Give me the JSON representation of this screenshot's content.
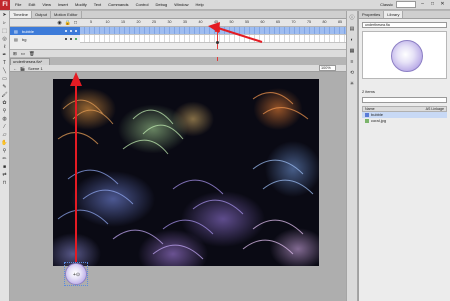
{
  "app": {
    "logo": "Fl"
  },
  "menu": [
    "File",
    "Edit",
    "View",
    "Insert",
    "Modify",
    "Text",
    "Commands",
    "Control",
    "Debug",
    "Window",
    "Help"
  ],
  "workspace": {
    "label": "Classic",
    "minimize": "–",
    "maximize": "□",
    "close": "✕"
  },
  "timeline": {
    "tabs": [
      "Timeline",
      "Output",
      "Motion Editor"
    ],
    "ruler_ticks": [
      "5",
      "10",
      "15",
      "20",
      "25",
      "30",
      "35",
      "40",
      "45",
      "50",
      "55",
      "60",
      "65",
      "70",
      "75",
      "80",
      "85"
    ],
    "layers": [
      {
        "name": "bubble",
        "selected": true
      },
      {
        "name": "bg",
        "selected": false
      }
    ],
    "current_frame": 45
  },
  "document": {
    "tab": "underthesea.fla*",
    "scene": "Scene 1",
    "zoom": "100%"
  },
  "library": {
    "tabs": [
      "Properties",
      "Library"
    ],
    "document": "underthesea.fla",
    "item_count": "2 items",
    "header_name": "Name",
    "header_linkage": "AS Linkage",
    "items": [
      {
        "name": "bubble",
        "kind": "symbol"
      },
      {
        "name": "coral.jpg",
        "kind": "bitmap"
      }
    ]
  },
  "annotation_color": "#e41b23"
}
